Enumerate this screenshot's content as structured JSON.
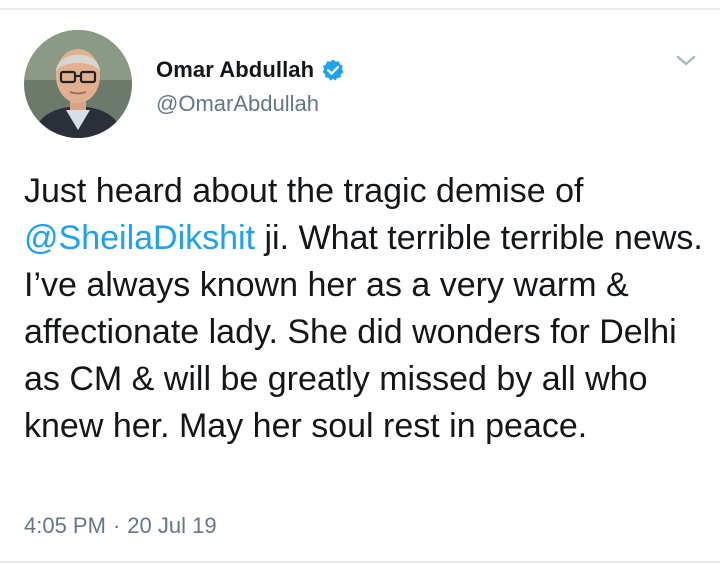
{
  "tweet": {
    "author": {
      "display_name": "Omar Abdullah",
      "handle": "@OmarAbdullah",
      "verified_icon": "verified-badge-icon",
      "avatar_icon": "profile-photo"
    },
    "menu_icon": "chevron-down-icon",
    "text": {
      "part1": "Just heard about the tragic demise of",
      "mention": "@SheilaDikshit",
      "part2": " ji. What terrible terrible news. I’ve always known her as a very warm & affectionate lady. She did wonders for Delhi as CM & will be greatly missed by all who knew her. May her soul rest in peace."
    },
    "time": "4:05 PM",
    "separator": "·",
    "date": "20 Jul 19"
  },
  "colors": {
    "text": "#14171a",
    "secondary": "#657786",
    "link": "#1da1f2",
    "verified": "#1da1f2",
    "divider": "#e6ecf0"
  }
}
